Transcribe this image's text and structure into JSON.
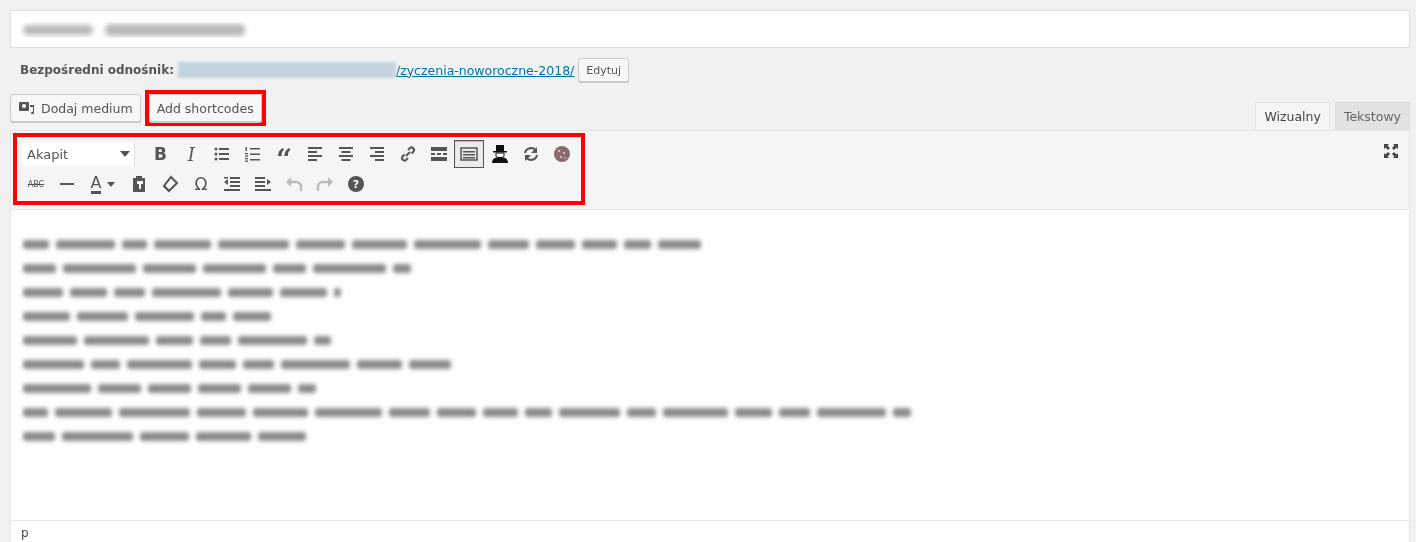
{
  "permalink": {
    "label": "Bezpośredni odnośnik:",
    "slug": "/zyczenia-noworoczne-2018/",
    "edit_button": "Edytuj"
  },
  "media_buttons": [
    {
      "label": "Dodaj medium",
      "kind": "media",
      "highlighted": false
    },
    {
      "label": "Add shortcodes",
      "kind": "plain",
      "highlighted": true
    }
  ],
  "editor_tabs": [
    {
      "label": "Wizualny",
      "selected": true
    },
    {
      "label": "Tekstowy",
      "selected": false
    }
  ],
  "toolbar": {
    "highlighted": true,
    "rows": [
      [
        {
          "kind": "select",
          "value": "Akapit"
        },
        {
          "kind": "bold",
          "text": "B",
          "pressed": false,
          "disabled": false
        },
        {
          "kind": "italic",
          "text": "I",
          "pressed": false,
          "disabled": false
        },
        {
          "kind": "bullist",
          "pressed": false,
          "disabled": false
        },
        {
          "kind": "numlist",
          "pressed": false,
          "disabled": false
        },
        {
          "kind": "quote",
          "text": "“",
          "pressed": false,
          "disabled": false
        },
        {
          "kind": "alignleft",
          "pressed": false,
          "disabled": false
        },
        {
          "kind": "aligncenter",
          "pressed": false,
          "disabled": false
        },
        {
          "kind": "alignright",
          "pressed": false,
          "disabled": false
        },
        {
          "kind": "link",
          "pressed": false,
          "disabled": false
        },
        {
          "kind": "more",
          "pressed": false,
          "disabled": false
        },
        {
          "kind": "kitchensink",
          "pressed": true,
          "disabled": false
        },
        {
          "kind": "hatman",
          "pressed": false,
          "disabled": false
        },
        {
          "kind": "refresh",
          "pressed": false,
          "disabled": false
        },
        {
          "kind": "cookie",
          "pressed": false,
          "disabled": false
        }
      ],
      [
        {
          "kind": "strike",
          "text": "ABC",
          "pressed": false,
          "disabled": false
        },
        {
          "kind": "hr",
          "pressed": false,
          "disabled": false
        },
        {
          "kind": "forecolor",
          "text": "A",
          "pressed": false,
          "disabled": false
        },
        {
          "kind": "paste",
          "pressed": false,
          "disabled": false
        },
        {
          "kind": "eraser",
          "pressed": false,
          "disabled": false
        },
        {
          "kind": "charmap",
          "text": "Ω",
          "pressed": false,
          "disabled": false
        },
        {
          "kind": "outdent",
          "pressed": false,
          "disabled": false
        },
        {
          "kind": "indent",
          "pressed": false,
          "disabled": false
        },
        {
          "kind": "undo",
          "pressed": false,
          "disabled": true
        },
        {
          "kind": "redo",
          "pressed": false,
          "disabled": true
        },
        {
          "kind": "help",
          "text": "?",
          "pressed": false,
          "disabled": false
        }
      ]
    ]
  },
  "status_path": "p"
}
